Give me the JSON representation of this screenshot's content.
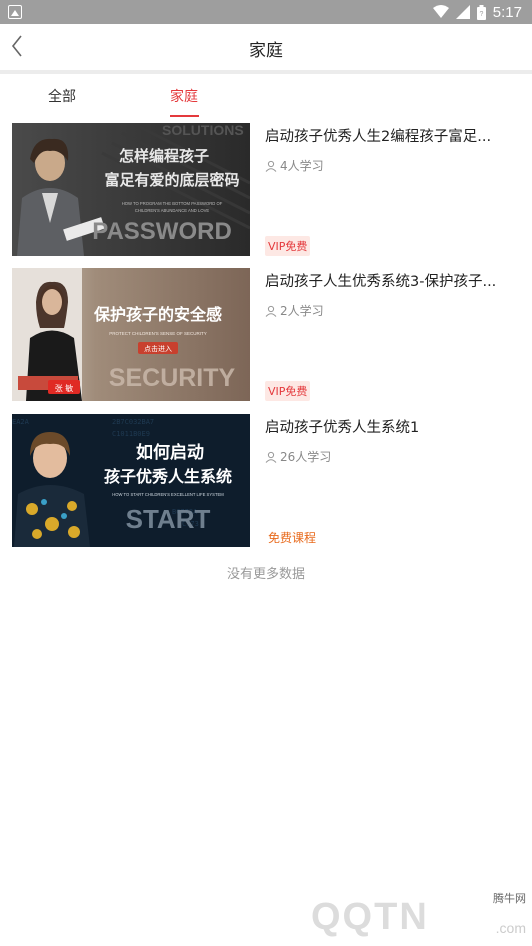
{
  "status_bar": {
    "time": "5:17"
  },
  "header": {
    "title": "家庭"
  },
  "tabs": [
    {
      "label": "全部",
      "active": false
    },
    {
      "label": "家庭",
      "active": true
    }
  ],
  "courses": [
    {
      "title": "启动孩子优秀人生2编程孩子富足...",
      "learners": "4人学习",
      "badge": "VIP免费",
      "thumb": {
        "line1": "怎样编程孩子",
        "line2": "富足有爱的底层密码",
        "sub1": "HOW TO PROGRAM THE BOTTOM PASSWORD OF",
        "sub2": "CHILDREN'S ABUNDANCE AND LOVE",
        "big": "PASSWORD",
        "bg_text": "SOLUTIONS"
      }
    },
    {
      "title": "启动孩子人生优秀系统3-保护孩子...",
      "learners": "2人学习",
      "badge": "VIP免费",
      "thumb": {
        "line1": "保护孩子的安全感",
        "sub1": "PROTECT CHILDREN'S SENSE OF SECURITY",
        "button": "点击进入",
        "name_tag": "张 敏",
        "big": "SECURITY"
      }
    },
    {
      "title": "启动孩子优秀人生系统1",
      "learners": "26人学习",
      "badge": "免费课程",
      "thumb": {
        "line1": "如何启动",
        "line2": "孩子优秀人生系统",
        "sub1": "HOW TO START CHILDREN'S EXCELLENT LIFE SYSTEM",
        "big": "START"
      }
    }
  ],
  "footer_text": "没有更多数据",
  "watermark": {
    "site": "腾牛网",
    "logo": "QQTN",
    "suffix": ".com"
  },
  "colors": {
    "accent": "#e4393c",
    "status_bar": "#9e9e9e"
  }
}
